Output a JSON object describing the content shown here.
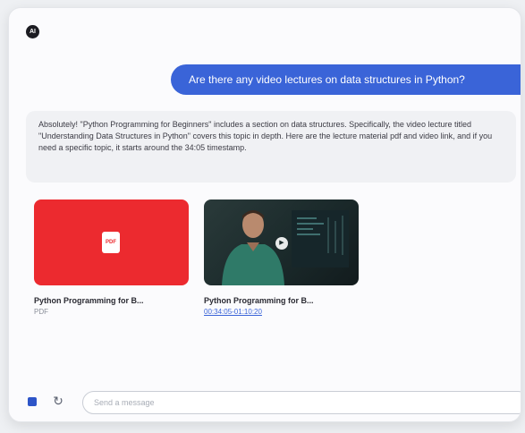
{
  "logo": {
    "text": "AI"
  },
  "conversation": {
    "user_message": "Are there any video lectures on data structures in Python?",
    "assistant_message": "Absolutely! \"Python Programming for Beginners\" includes a section on data structures. Specifically, the video lecture titled \"Understanding Data Structures in Python\" covers this topic in depth. Here are the lecture material pdf and video link, and if you need a specific topic, it starts around the 34:05 timestamp."
  },
  "attachments": [
    {
      "title": "Python Programming for B...",
      "subtitle": "PDF",
      "icon": "pdf-icon",
      "thumb_color": "#ec2a2f"
    },
    {
      "title": "Python Programming for B...",
      "subtitle": "00:34:05-01:10:20",
      "icon": "play-icon"
    }
  ],
  "composer": {
    "placeholder": "Send a message",
    "stop_icon": "stop-icon",
    "refresh_icon": "refresh-icon"
  },
  "colors": {
    "accent": "#3a64d8",
    "pdf_red": "#ec2a2f"
  }
}
